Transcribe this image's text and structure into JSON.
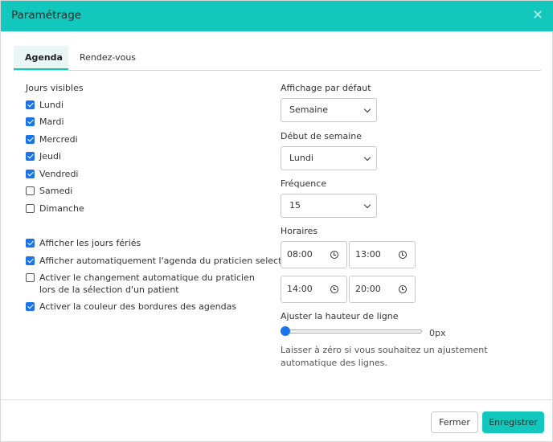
{
  "modal": {
    "title": "Paramétrage"
  },
  "tabs": [
    {
      "label": "Agenda",
      "active": true
    },
    {
      "label": "Rendez-vous",
      "active": false
    }
  ],
  "visible_days": {
    "label": "Jours visibles",
    "days": [
      {
        "label": "Lundi",
        "checked": true
      },
      {
        "label": "Mardi",
        "checked": true
      },
      {
        "label": "Mercredi",
        "checked": true
      },
      {
        "label": "Jeudi",
        "checked": true
      },
      {
        "label": "Vendredi",
        "checked": true
      },
      {
        "label": "Samedi",
        "checked": false
      },
      {
        "label": "Dimanche",
        "checked": false
      }
    ]
  },
  "options": [
    {
      "label": "Afficher les jours fériés",
      "checked": true
    },
    {
      "label": "Afficher automatiquement l'agenda du praticien selectionné",
      "checked": true
    },
    {
      "label": "Activer le changement automatique du praticien lors de la sélection d'un patient",
      "checked": false
    },
    {
      "label": "Activer la couleur des bordures des agendas",
      "checked": true
    }
  ],
  "default_view": {
    "label": "Affichage par défaut",
    "value": "Semaine"
  },
  "week_start": {
    "label": "Début de semaine",
    "value": "Lundi"
  },
  "frequency": {
    "label": "Fréquence",
    "value": "15"
  },
  "hours": {
    "label": "Horaires",
    "morning_start": "08:00",
    "morning_end": "13:00",
    "afternoon_start": "14:00",
    "afternoon_end": "20:00"
  },
  "row_height": {
    "label": "Ajuster la hauteur de ligne",
    "value": "0px",
    "hint": "Laisser à zéro si vous souhaitez un ajustement automatique des lignes."
  },
  "footer": {
    "close_label": "Fermer",
    "save_label": "Enregistrer"
  },
  "colors": {
    "accent": "#12c8bd",
    "checkbox": "#1a73e8"
  }
}
